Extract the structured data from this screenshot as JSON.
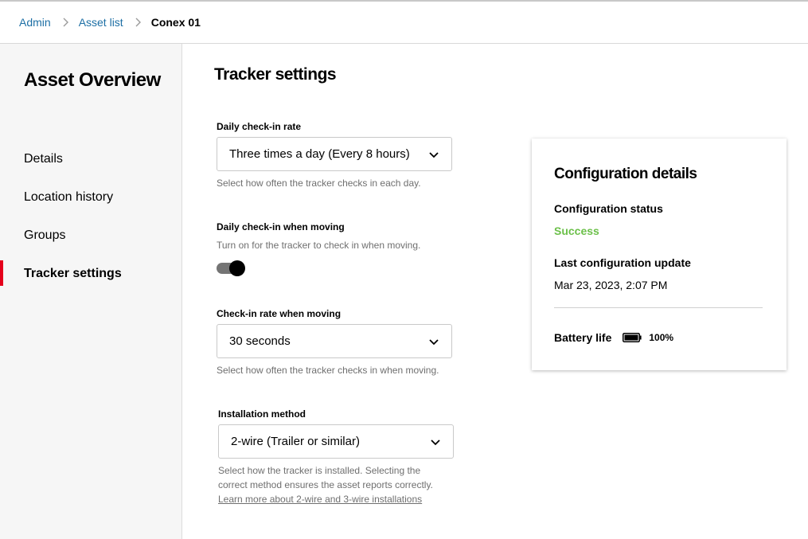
{
  "breadcrumb": {
    "items": [
      "Admin",
      "Asset list"
    ],
    "current": "Conex 01"
  },
  "sidebar": {
    "title": "Asset Overview",
    "items": [
      {
        "label": "Details"
      },
      {
        "label": "Location history"
      },
      {
        "label": "Groups"
      },
      {
        "label": "Tracker settings",
        "active": true
      }
    ]
  },
  "main": {
    "title": "Tracker settings",
    "daily_rate": {
      "label": "Daily check-in rate",
      "value": "Three times a day (Every 8 hours)",
      "help": "Select how often the tracker checks in each day."
    },
    "moving_checkin": {
      "label": "Daily check-in when moving",
      "help": "Turn on for the tracker to check in when moving.",
      "enabled": true
    },
    "moving_rate": {
      "label": "Check-in rate when moving",
      "value": "30 seconds",
      "help": "Select how often the tracker checks in when moving."
    },
    "installation": {
      "label": "Installation method",
      "value": "2-wire (Trailer or similar)",
      "help_line1": "Select how the tracker is installed. Selecting the",
      "help_line2": "correct method ensures the asset reports correctly.",
      "link": "Learn more about 2-wire and 3-wire installations"
    }
  },
  "config_card": {
    "title": "Configuration details",
    "status_label": "Configuration status",
    "status_value": "Success",
    "update_label": "Last configuration update",
    "update_value": "Mar 23, 2023, 2:07 PM",
    "battery_label": "Battery life",
    "battery_value": "100%",
    "battery_level": 1.0
  },
  "colors": {
    "link": "#1d6fa5",
    "accent": "#e5001b",
    "success": "#6cc04a"
  }
}
